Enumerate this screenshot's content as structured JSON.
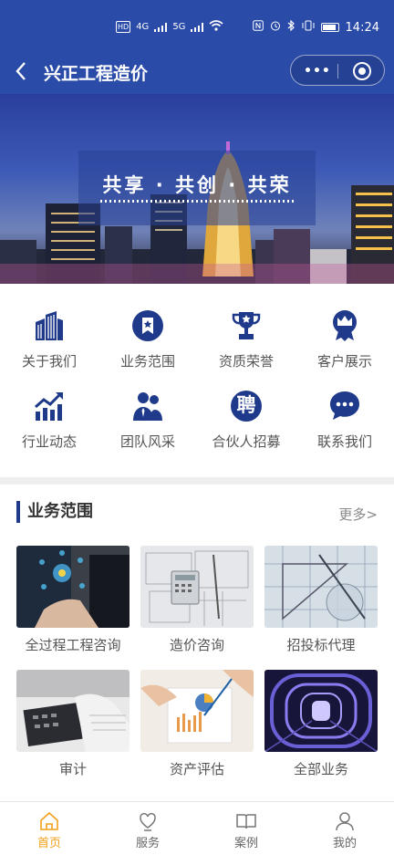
{
  "status_bar": {
    "left_label": "HD",
    "net1": "4G",
    "net2": "5G",
    "time": "14:24"
  },
  "nav": {
    "title": "兴正工程造价",
    "more_label": "•••"
  },
  "banner": {
    "slogan": "共享 · 共创 · 共荣"
  },
  "grid": [
    {
      "label": "关于我们",
      "icon": "buildings-icon"
    },
    {
      "label": "业务范围",
      "icon": "bookmark-badge-icon"
    },
    {
      "label": "资质荣誉",
      "icon": "trophy-icon"
    },
    {
      "label": "客户展示",
      "icon": "crown-badge-icon"
    },
    {
      "label": "行业动态",
      "icon": "trend-chart-icon"
    },
    {
      "label": "团队风采",
      "icon": "team-icon"
    },
    {
      "label": "合伙人招募",
      "icon": "recruit-icon",
      "glyph": "聘"
    },
    {
      "label": "联系我们",
      "icon": "chat-bubble-icon"
    }
  ],
  "section": {
    "title": "业务范围",
    "more": "更多>"
  },
  "cards": [
    {
      "label": "全过程工程咨询"
    },
    {
      "label": "造价咨询"
    },
    {
      "label": "招投标代理"
    },
    {
      "label": "审计"
    },
    {
      "label": "资产评估"
    },
    {
      "label": "全部业务"
    }
  ],
  "tabs": [
    {
      "label": "首页",
      "icon": "home-icon"
    },
    {
      "label": "服务",
      "icon": "service-heart-icon"
    },
    {
      "label": "案例",
      "icon": "book-icon"
    },
    {
      "label": "我的",
      "icon": "user-icon"
    }
  ],
  "colors": {
    "brand": "#2a4ba8",
    "icon_blue": "#1f3a8a",
    "active_tab": "#f0a11a"
  }
}
